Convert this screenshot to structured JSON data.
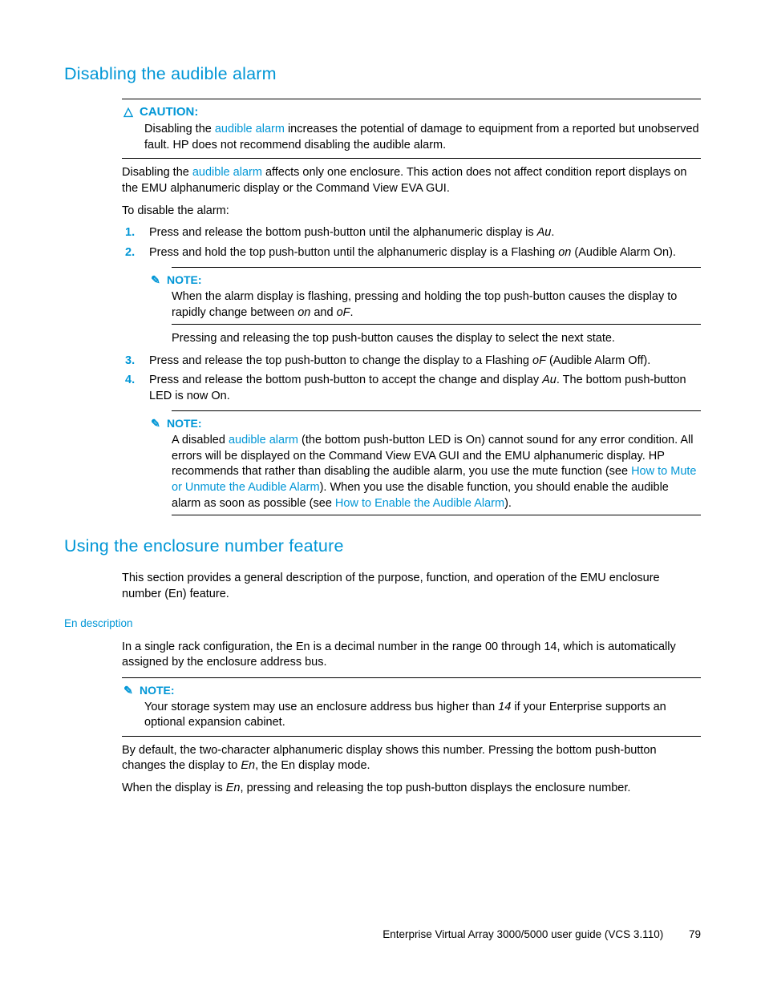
{
  "sections": {
    "s1": {
      "title": "Disabling the audible alarm",
      "caution": {
        "label": "CAUTION:",
        "pre": "Disabling the ",
        "link": "audible alarm",
        "post": " increases the potential of damage to equipment from a reported but unobserved fault. HP does not recommend disabling the audible alarm."
      },
      "p1_pre": "Disabling the ",
      "p1_link": "audible alarm",
      "p1_post": " affects only one enclosure. This action does not affect condition report displays on the EMU alphanumeric display or the Command View EVA GUI.",
      "p2": "To disable the alarm:",
      "step1_a": "Press and release the bottom push-button until the alphanumeric display is ",
      "step1_i": "Au",
      "step1_b": ".",
      "step2_a": "Press and hold the top push-button until the alphanumeric display is a Flashing ",
      "step2_i": "on",
      "step2_b": " (Audible Alarm On).",
      "note1": {
        "label": "NOTE:",
        "a": "When the alarm display is flashing, pressing and holding the top push-button causes the display to rapidly change between ",
        "i1": "on",
        "mid": " and ",
        "i2": "oF",
        "b": "."
      },
      "note1_after": "Pressing and releasing the top push-button causes the display to select the next state.",
      "step3_a": "Press and release the top push-button to change the display to a Flashing ",
      "step3_i": "oF",
      "step3_b": " (Audible Alarm Off).",
      "step4_a": "Press and release the bottom push-button to accept the change and display ",
      "step4_i": "Au",
      "step4_b": ". The bottom push-button LED is now On.",
      "note2": {
        "label": "NOTE:",
        "a": "A disabled ",
        "link1": "audible alarm",
        "b": " (the bottom push-button LED is On) cannot sound for any error condition. All errors will be displayed on the Command View EVA GUI and the EMU alphanumeric display. HP recommends that rather than disabling the audible alarm, you use the mute function (see ",
        "link2": "How to Mute or Unmute the Audible Alarm",
        "c": "). When you use the disable function, you should enable the audible alarm as soon as possible (see ",
        "link3": "How to Enable the Audible Alarm",
        "d": ")."
      }
    },
    "s2": {
      "title": "Using the enclosure number feature",
      "p1": "This section provides a general description of the purpose, function, and operation of the EMU enclosure number (En) feature.",
      "sub": "En description",
      "p2": "In a single rack configuration, the En is a decimal number in the range 00 through 14, which is automatically assigned by the enclosure address bus.",
      "note": {
        "label": "NOTE:",
        "a": "Your storage system may use an enclosure address bus higher than ",
        "i": "14",
        "b": " if your Enterprise supports an optional expansion cabinet."
      },
      "p3_a": "By default, the two-character alphanumeric display shows this number. Pressing the bottom push-button changes the display to ",
      "p3_i": "En",
      "p3_b": ", the En display mode.",
      "p4_a": "When the display is ",
      "p4_i": "En",
      "p4_b": ", pressing and releasing the top push-button displays the enclosure number."
    }
  },
  "numbers": {
    "n1": "1.",
    "n2": "2.",
    "n3": "3.",
    "n4": "4."
  },
  "icons": {
    "caution": "△",
    "note": "✎"
  },
  "footer": {
    "title": "Enterprise Virtual Array 3000/5000 user guide (VCS 3.110)",
    "page": "79"
  }
}
